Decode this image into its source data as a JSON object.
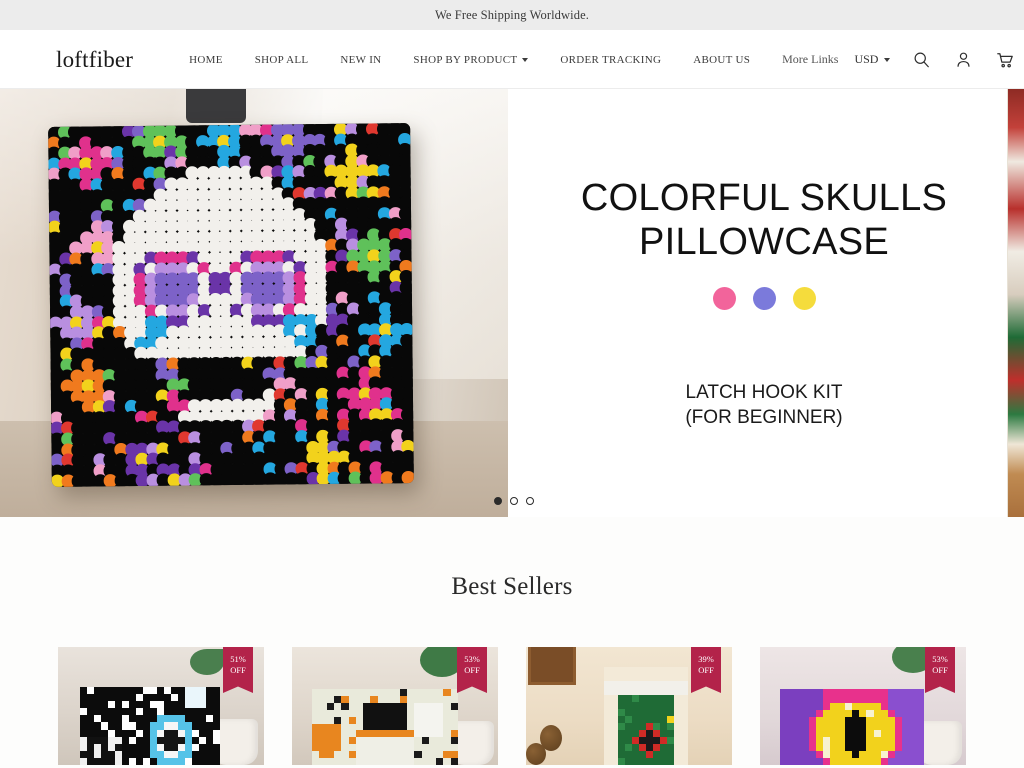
{
  "announcement": {
    "text": "We Free Shipping Worldwide."
  },
  "header": {
    "logo": "loftfiber",
    "nav": [
      {
        "label": "HOME",
        "has_caret": false
      },
      {
        "label": "SHOP ALL",
        "has_caret": false
      },
      {
        "label": "NEW IN",
        "has_caret": false
      },
      {
        "label": "SHOP BY PRODUCT",
        "has_caret": true
      },
      {
        "label": "ORDER TRACKING",
        "has_caret": false
      },
      {
        "label": "ABOUT US",
        "has_caret": false
      },
      {
        "label": "More Links",
        "has_caret": false
      }
    ],
    "currency": "USD",
    "icons": [
      "search-icon",
      "account-icon",
      "cart-icon"
    ]
  },
  "hero": {
    "title_line1": "COLORFUL SKULLS",
    "title_line2": "PILLOWCASE",
    "subtitle_line1": "LATCH HOOK KIT",
    "subtitle_line2": "(FOR BEGINNER)",
    "swatches": [
      {
        "name": "pink",
        "hex": "#F2649B"
      },
      {
        "name": "periwinkle",
        "hex": "#7B7ADB"
      },
      {
        "name": "yellow",
        "hex": "#F5DC3C"
      }
    ],
    "slides_total": 3,
    "active_slide": 1,
    "image_alt": "Colorful sugar skull latch hook pillowcase"
  },
  "best_sellers": {
    "heading": "Best Sellers",
    "products": [
      {
        "discount_pct": "51%",
        "discount_label": "OFF",
        "alt": "Penguin winter latch hook pillow"
      },
      {
        "discount_pct": "53%",
        "discount_label": "OFF",
        "alt": "Halloween ghost pumpkin latch hook pillow"
      },
      {
        "discount_pct": "39%",
        "discount_label": "OFF",
        "alt": "Christmas gnome latch hook stocking"
      },
      {
        "discount_pct": "53%",
        "discount_label": "OFF",
        "alt": "Halloween witch moon latch hook pillow"
      }
    ],
    "badge_color": "#B3234A"
  }
}
